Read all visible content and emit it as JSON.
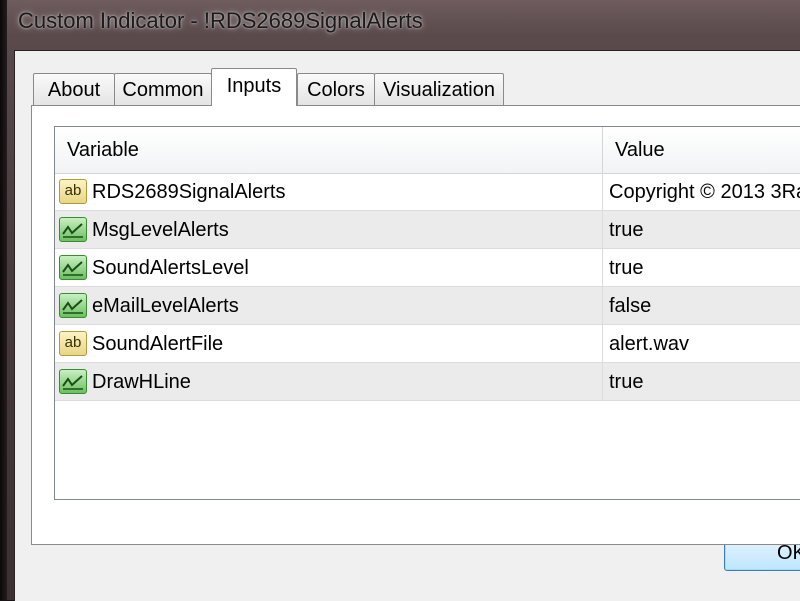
{
  "window": {
    "title": "Custom Indicator - !RDS2689SignalAlerts"
  },
  "tabs": [
    {
      "label": "About"
    },
    {
      "label": "Common"
    },
    {
      "label": "Inputs",
      "active": true
    },
    {
      "label": "Colors"
    },
    {
      "label": "Visualization"
    }
  ],
  "grid": {
    "columns": {
      "variable": "Variable",
      "value": "Value"
    },
    "rows": [
      {
        "icon": "string-icon",
        "name": "RDS2689SignalAlerts",
        "value": "Copyright © 2013 3Ra"
      },
      {
        "icon": "boolean-icon",
        "name": "MsgLevelAlerts",
        "value": "true"
      },
      {
        "icon": "boolean-icon",
        "name": "SoundAlertsLevel",
        "value": "true"
      },
      {
        "icon": "boolean-icon",
        "name": "eMailLevelAlerts",
        "value": "false"
      },
      {
        "icon": "string-icon",
        "name": "SoundAlertFile",
        "value": "alert.wav"
      },
      {
        "icon": "boolean-icon",
        "name": "DrawHLine",
        "value": "true"
      }
    ]
  },
  "icon_text": {
    "string": "ab"
  },
  "buttons": {
    "ok": "OK"
  }
}
